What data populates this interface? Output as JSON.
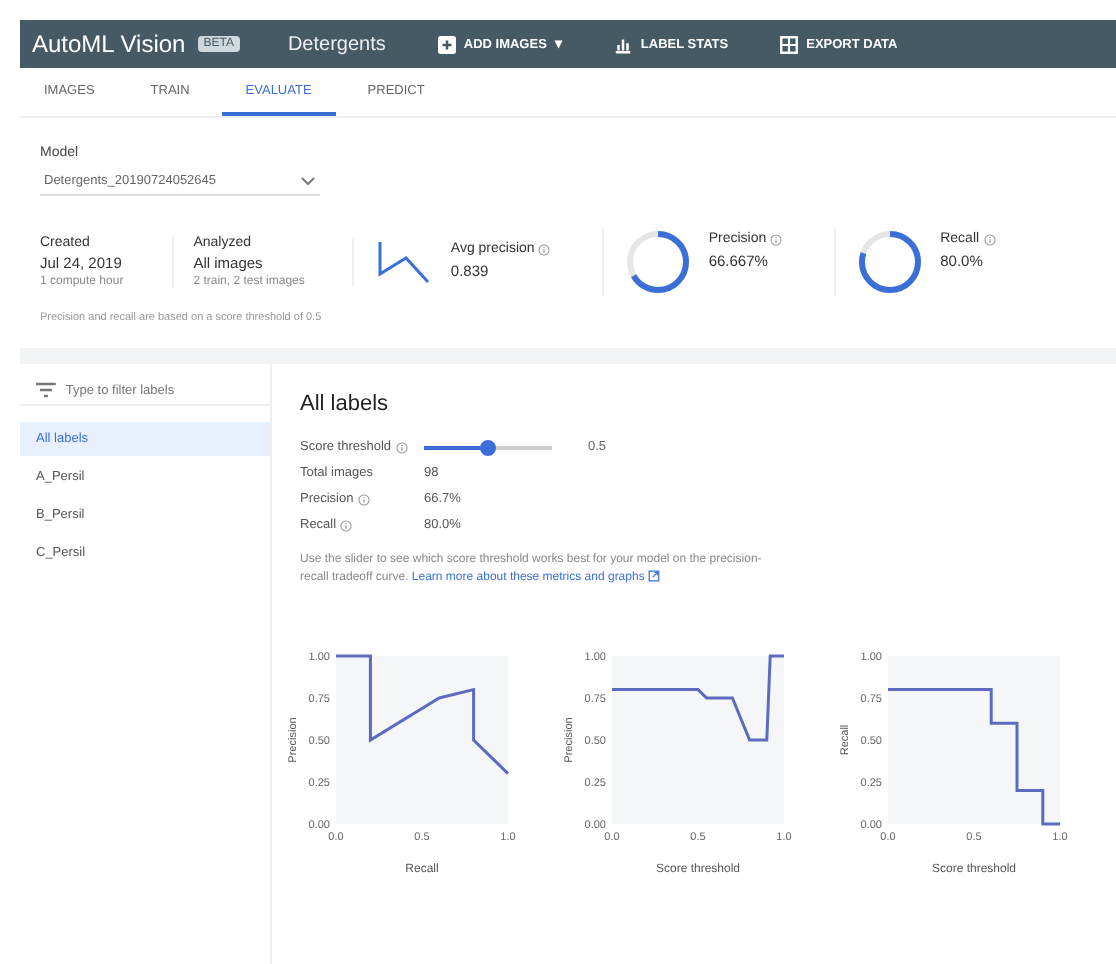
{
  "header": {
    "product": "AutoML Vision",
    "badge": "BETA",
    "dataset": "Detergents",
    "actions": [
      {
        "kind": "add",
        "label": "ADD IMAGES",
        "caret": "▾"
      },
      {
        "kind": "stats",
        "label": "LABEL STATS"
      },
      {
        "kind": "export",
        "label": "EXPORT DATA"
      }
    ]
  },
  "tabs": [
    {
      "label": "IMAGES",
      "selected": false
    },
    {
      "label": "TRAIN",
      "selected": false
    },
    {
      "label": "EVALUATE",
      "selected": true
    },
    {
      "label": "PREDICT",
      "selected": false
    }
  ],
  "model": {
    "label": "Model",
    "value": "Detergents_20190724052645"
  },
  "summary": {
    "created": {
      "label": "Created",
      "value": "Jul 24, 2019",
      "note": "1 compute hour"
    },
    "analyzed": {
      "label": "Analyzed",
      "value": "All images",
      "note": "2 train, 2 test images"
    },
    "avg_precision": {
      "label": "Avg precision",
      "value": "0.839"
    },
    "precision": {
      "label": "Precision",
      "value": "66.667%",
      "level": 0.667
    },
    "recall": {
      "label": "Recall",
      "value": "80.0%",
      "level": 0.8
    },
    "footnote": "Precision and recall are based on a score threshold of 0.5"
  },
  "filter": {
    "placeholder": "Type to filter labels"
  },
  "labels": [
    {
      "name": "All labels",
      "selected": true
    },
    {
      "name": "A_Persil",
      "selected": false
    },
    {
      "name": "B_Persil",
      "selected": false
    },
    {
      "name": "C_Persil",
      "selected": false
    }
  ],
  "detail": {
    "title": "All labels",
    "threshold": {
      "label": "Score threshold",
      "level": 0.5,
      "reading": "0.5"
    },
    "rows": [
      {
        "label": "Total images",
        "value": "98"
      },
      {
        "label": "Precision",
        "value": "66.7%",
        "info": true
      },
      {
        "label": "Recall",
        "value": "80.0%",
        "info": true
      }
    ],
    "text": "Use the slider to see which score threshold works best for your model on the precision-recall tradeoff curve.",
    "link": "Learn more about these metrics and graphs"
  },
  "charts": [
    {
      "chart_data": {
        "type": "line",
        "xlabel": "Recall",
        "ylabel": "Precision",
        "x": [
          0,
          0.2,
          0.2,
          0.6,
          0.8,
          0.8,
          1.0
        ],
        "series": [
          {
            "color": "#5c6bc0",
            "values": [
              1.0,
              1.0,
              0.5,
              0.75,
              0.8,
              0.5,
              0.3
            ]
          }
        ],
        "xlim": [
          0,
          1
        ],
        "ylim": [
          0,
          1
        ],
        "xticks": [
          {
            "value": 0,
            "label": "0.0"
          },
          {
            "value": 0.5,
            "label": "0.5"
          },
          {
            "value": 1,
            "label": "1.0"
          }
        ],
        "yticks": [
          {
            "value": 0,
            "label": "0.00"
          },
          {
            "value": 0.25,
            "label": "0.25"
          },
          {
            "value": 0.5,
            "label": "0.50"
          },
          {
            "value": 0.75,
            "label": "0.75"
          },
          {
            "value": 1,
            "label": "1.00"
          }
        ]
      }
    },
    {
      "chart_data": {
        "type": "line",
        "xlabel": "Score threshold",
        "ylabel": "Precision",
        "x": [
          0,
          0.5,
          0.55,
          0.7,
          0.8,
          0.82,
          0.9,
          0.92,
          1.0
        ],
        "series": [
          {
            "color": "#5c6bc0",
            "values": [
              0.8,
              0.8,
              0.75,
              0.75,
              0.5,
              0.5,
              0.5,
              1.0,
              1.0
            ]
          }
        ],
        "xlim": [
          0,
          1
        ],
        "ylim": [
          0,
          1
        ],
        "xticks": [
          {
            "value": 0,
            "label": "0.0"
          },
          {
            "value": 0.5,
            "label": "0.5"
          },
          {
            "value": 1,
            "label": "1.0"
          }
        ],
        "yticks": [
          {
            "value": 0,
            "label": "0.00"
          },
          {
            "value": 0.25,
            "label": "0.25"
          },
          {
            "value": 0.5,
            "label": "0.50"
          },
          {
            "value": 0.75,
            "label": "0.75"
          },
          {
            "value": 1,
            "label": "1.00"
          }
        ]
      }
    },
    {
      "chart_data": {
        "type": "line",
        "xlabel": "Score threshold",
        "ylabel": "Recall",
        "x": [
          0,
          0.5,
          0.6,
          0.6,
          0.75,
          0.75,
          0.9,
          0.9,
          1.0
        ],
        "series": [
          {
            "color": "#5c6bc0",
            "values": [
              0.8,
              0.8,
              0.8,
              0.6,
              0.6,
              0.2,
              0.2,
              0.0,
              0.0
            ]
          }
        ],
        "xlim": [
          0,
          1
        ],
        "ylim": [
          0,
          1
        ],
        "xticks": [
          {
            "value": 0,
            "label": "0.0"
          },
          {
            "value": 0.5,
            "label": "0.5"
          },
          {
            "value": 1,
            "label": "1.0"
          }
        ],
        "yticks": [
          {
            "value": 0,
            "label": "0.00"
          },
          {
            "value": 0.25,
            "label": "0.25"
          },
          {
            "value": 0.5,
            "label": "0.50"
          },
          {
            "value": 0.75,
            "label": "0.75"
          },
          {
            "value": 1,
            "label": "1.00"
          }
        ]
      }
    }
  ]
}
